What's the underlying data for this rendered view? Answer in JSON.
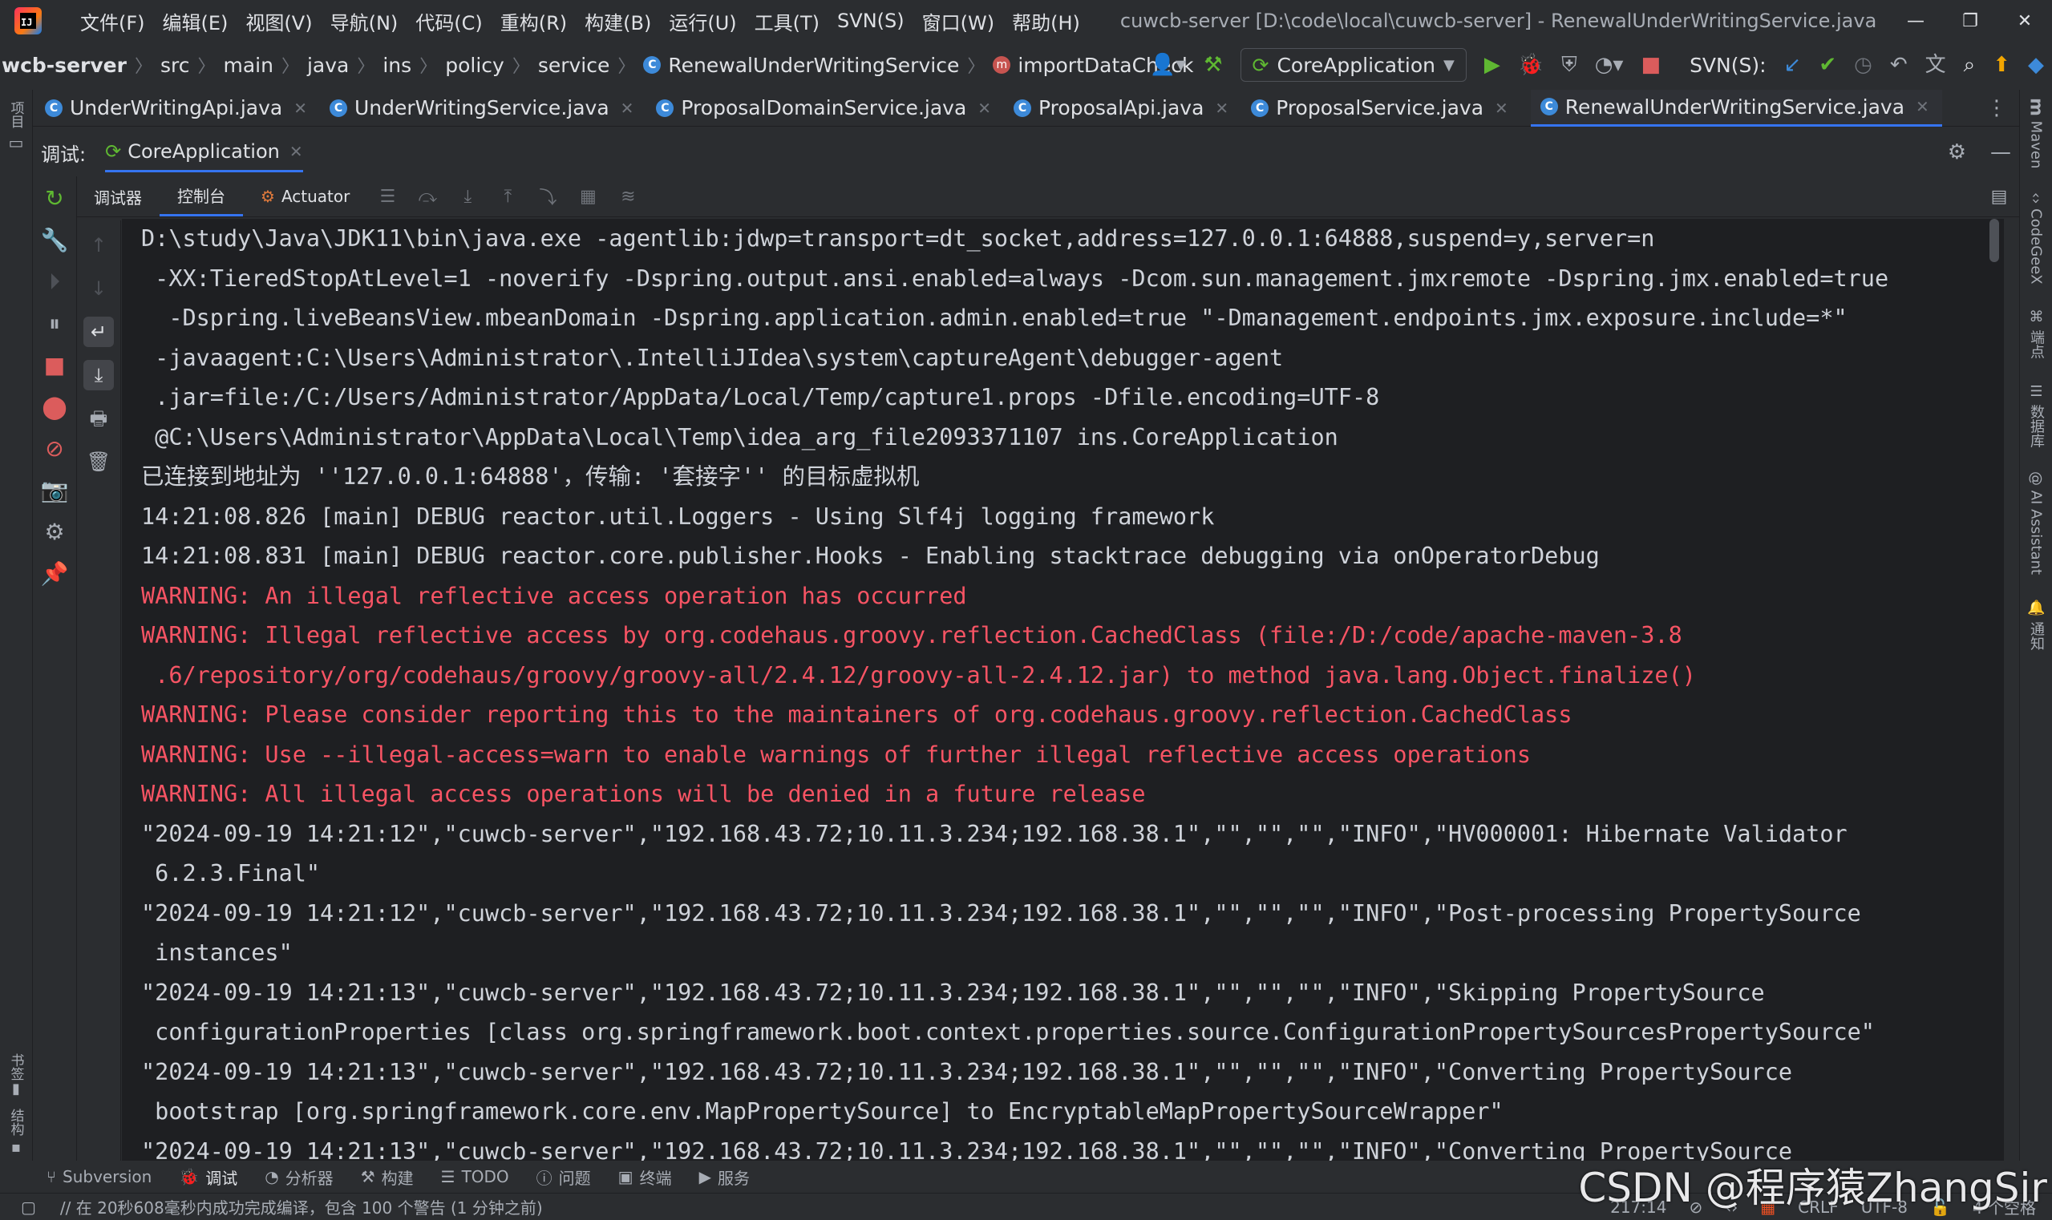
{
  "menubar": {
    "items": [
      "文件(F)",
      "编辑(E)",
      "视图(V)",
      "导航(N)",
      "代码(C)",
      "重构(R)",
      "构建(B)",
      "运行(U)",
      "工具(T)",
      "SVN(S)",
      "窗口(W)",
      "帮助(H)"
    ],
    "title": "cuwcb-server [D:\\code\\local\\cuwcb-server] - RenewalUnderWritingService.java"
  },
  "navbar": {
    "crumbs": [
      "wcb-server",
      "src",
      "main",
      "java",
      "ins",
      "policy",
      "service"
    ],
    "class_name": "RenewalUnderWritingService",
    "method_name": "importDataCheck",
    "run_config": "CoreApplication",
    "svn_label": "SVN(S):"
  },
  "tabs": [
    {
      "label": "UnderWritingApi.java"
    },
    {
      "label": "UnderWritingService.java"
    },
    {
      "label": "ProposalDomainService.java"
    },
    {
      "label": "ProposalApi.java"
    },
    {
      "label": "ProposalService.java"
    },
    {
      "label": "RenewalUnderWritingService.java"
    }
  ],
  "left_strip": {
    "project_label": "项目",
    "bookmarks_label": "书签",
    "structure_label": "结构"
  },
  "right_strip": {
    "maven": "Maven",
    "codegeex": "CodeGeeX",
    "endpoints": "端点",
    "database": "数据库",
    "ai_assistant": "AI Assistant",
    "notifications": "通知"
  },
  "debug": {
    "label": "调试:",
    "session": "CoreApplication",
    "tabs": {
      "debugger": "调试器",
      "console": "控制台",
      "actuator": "Actuator"
    }
  },
  "console": {
    "lines": [
      {
        "text": "D:\\study\\Java\\JDK11\\bin\\java.exe -agentlib:jdwp=transport=dt_socket,address=127.0.0.1:64888,suspend=y,server=n",
        "type": "normal"
      },
      {
        "text": " -XX:TieredStopAtLevel=1 -noverify -Dspring.output.ansi.enabled=always -Dcom.sun.management.jmxremote -Dspring.jmx.enabled=true",
        "type": "normal"
      },
      {
        "text": "  -Dspring.liveBeansView.mbeanDomain -Dspring.application.admin.enabled=true \"-Dmanagement.endpoints.jmx.exposure.include=*\"",
        "type": "normal"
      },
      {
        "text": " -javaagent:C:\\Users\\Administrator\\.IntelliJIdea\\system\\captureAgent\\debugger-agent",
        "type": "normal"
      },
      {
        "text": " .jar=file:/C:/Users/Administrator/AppData/Local/Temp/capture1.props -Dfile.encoding=UTF-8",
        "type": "normal"
      },
      {
        "text": " @C:\\Users\\Administrator\\AppData\\Local\\Temp\\idea_arg_file2093371107 ins.CoreApplication",
        "type": "normal"
      },
      {
        "text": "已连接到地址为 ''127.0.0.1:64888'，传输: '套接字'' 的目标虚拟机",
        "type": "normal"
      },
      {
        "text": "14:21:08.826 [main] DEBUG reactor.util.Loggers - Using Slf4j logging framework",
        "type": "normal"
      },
      {
        "text": "14:21:08.831 [main] DEBUG reactor.core.publisher.Hooks - Enabling stacktrace debugging via onOperatorDebug",
        "type": "normal"
      },
      {
        "text": "WARNING: An illegal reflective access operation has occurred",
        "type": "warn"
      },
      {
        "text": "WARNING: Illegal reflective access by org.codehaus.groovy.reflection.CachedClass (file:/D:/code/apache-maven-3.8",
        "type": "warn"
      },
      {
        "text": " .6/repository/org/codehaus/groovy/groovy-all/2.4.12/groovy-all-2.4.12.jar) to method java.lang.Object.finalize()",
        "type": "warn"
      },
      {
        "text": "WARNING: Please consider reporting this to the maintainers of org.codehaus.groovy.reflection.CachedClass",
        "type": "warn"
      },
      {
        "text": "WARNING: Use --illegal-access=warn to enable warnings of further illegal reflective access operations",
        "type": "warn"
      },
      {
        "text": "WARNING: All illegal access operations will be denied in a future release",
        "type": "warn"
      },
      {
        "text": "\"2024-09-19 14:21:12\",\"cuwcb-server\",\"192.168.43.72;10.11.3.234;192.168.38.1\",\"\",\"\",\"\",\"INFO\",\"HV000001: Hibernate Validator",
        "type": "normal"
      },
      {
        "text": " 6.2.3.Final\"",
        "type": "normal"
      },
      {
        "text": "\"2024-09-19 14:21:12\",\"cuwcb-server\",\"192.168.43.72;10.11.3.234;192.168.38.1\",\"\",\"\",\"\",\"INFO\",\"Post-processing PropertySource",
        "type": "normal"
      },
      {
        "text": " instances\"",
        "type": "normal"
      },
      {
        "text": "\"2024-09-19 14:21:13\",\"cuwcb-server\",\"192.168.43.72;10.11.3.234;192.168.38.1\",\"\",\"\",\"\",\"INFO\",\"Skipping PropertySource",
        "type": "normal"
      },
      {
        "text": " configurationProperties [class org.springframework.boot.context.properties.source.ConfigurationPropertySourcesPropertySource\"",
        "type": "normal"
      },
      {
        "text": "\"2024-09-19 14:21:13\",\"cuwcb-server\",\"192.168.43.72;10.11.3.234;192.168.38.1\",\"\",\"\",\"\",\"INFO\",\"Converting PropertySource",
        "type": "normal"
      },
      {
        "text": " bootstrap [org.springframework.core.env.MapPropertySource] to EncryptableMapPropertySourceWrapper\"",
        "type": "normal"
      },
      {
        "text": "\"2024-09-19 14:21:13\",\"cuwcb-server\",\"192.168.43.72;10.11.3.234;192.168.38.1\",\"\",\"\",\"\",\"INFO\",\"Converting PropertySource",
        "type": "normal"
      }
    ]
  },
  "bottom_tools": [
    {
      "label": "Subversion",
      "icon": "branch-icon"
    },
    {
      "label": "调试",
      "icon": "bug-icon",
      "active": true
    },
    {
      "label": "分析器",
      "icon": "profiler-icon"
    },
    {
      "label": "构建",
      "icon": "hammer-icon"
    },
    {
      "label": "TODO",
      "icon": "list-icon"
    },
    {
      "label": "问题",
      "icon": "info-icon"
    },
    {
      "label": "终端",
      "icon": "terminal-icon"
    },
    {
      "label": "服务",
      "icon": "play-icon"
    }
  ],
  "status": {
    "message": "// 在 20秒608毫秒内成功完成编译，包含 100 个警告 (1 分钟之前)",
    "position": "217:14",
    "line_ending": "CRLF",
    "encoding": "UTF-8",
    "indent": "4 个空格"
  },
  "watermark": "CSDN @程序猿ZhangSir",
  "colors": {
    "accent": "#3574f0",
    "warning_text": "#f75464",
    "console_bg": "#1e1f22",
    "ide_bg": "#2b2d30",
    "run_green": "#5fb832",
    "stop_red": "#db5c5c"
  }
}
